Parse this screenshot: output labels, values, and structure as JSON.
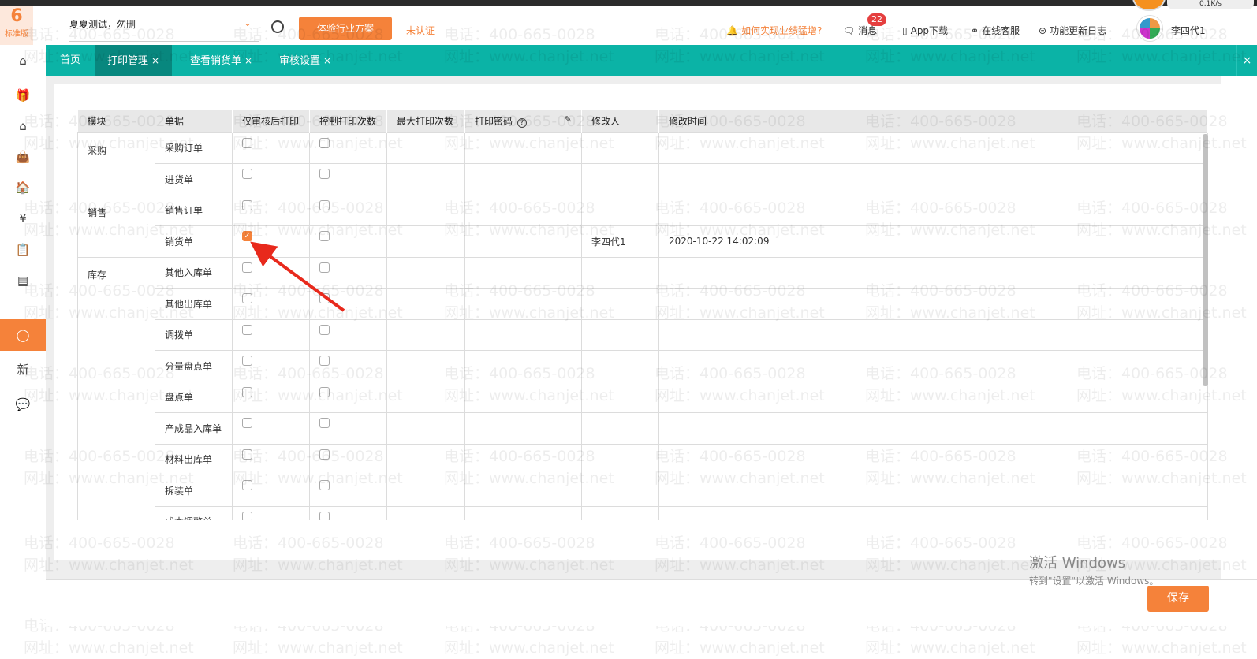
{
  "header": {
    "logo_text": "标准版",
    "company": "夏夏测试，勿删",
    "trial_button": "体验行业方案",
    "unverified": "未认证",
    "growth_link": "如何实现业绩猛增?",
    "messages": "消息",
    "message_count": "22",
    "app_download": "App下载",
    "online_service": "在线客服",
    "changelog": "功能更新日志",
    "username": "李四代1",
    "net_speed": "0.1K/s"
  },
  "tabs": [
    {
      "label": "首页",
      "closable": false
    },
    {
      "label": "打印管理",
      "closable": true,
      "active": true
    },
    {
      "label": "查看销货单",
      "closable": true
    },
    {
      "label": "审核设置",
      "closable": true
    }
  ],
  "tab_close_symbol": "×",
  "table": {
    "headers": [
      "模块",
      "单据",
      "仅审核后打印",
      "控制打印次数",
      "最大打印次数",
      "打印密码",
      "修改人",
      "修改时间"
    ],
    "groups": [
      {
        "module": "采购",
        "rows": [
          {
            "doc": "采购订单",
            "audit_only": false,
            "control": false,
            "modifier": "",
            "time": ""
          },
          {
            "doc": "进货单",
            "audit_only": false,
            "control": false,
            "modifier": "",
            "time": ""
          }
        ]
      },
      {
        "module": "销售",
        "rows": [
          {
            "doc": "销售订单",
            "audit_only": false,
            "control": false,
            "modifier": "",
            "time": ""
          },
          {
            "doc": "销货单",
            "audit_only": true,
            "control": false,
            "modifier": "李四代1",
            "time": "2020-10-22 14:02:09"
          }
        ]
      },
      {
        "module": "库存",
        "rows": [
          {
            "doc": "其他入库单",
            "audit_only": false,
            "control": false,
            "modifier": "",
            "time": ""
          },
          {
            "doc": "其他出库单",
            "audit_only": false,
            "control": false,
            "modifier": "",
            "time": ""
          },
          {
            "doc": "调拨单",
            "audit_only": false,
            "control": false,
            "modifier": "",
            "time": ""
          },
          {
            "doc": "分量盘点单",
            "audit_only": false,
            "control": false,
            "modifier": "",
            "time": ""
          },
          {
            "doc": "盘点单",
            "audit_only": false,
            "control": false,
            "modifier": "",
            "time": ""
          },
          {
            "doc": "产成品入库单",
            "audit_only": false,
            "control": false,
            "modifier": "",
            "time": ""
          },
          {
            "doc": "材料出库单",
            "audit_only": false,
            "control": false,
            "modifier": "",
            "time": ""
          },
          {
            "doc": "拆装单",
            "audit_only": false,
            "control": false,
            "modifier": "",
            "time": ""
          },
          {
            "doc": "成本调整单",
            "audit_only": false,
            "control": false,
            "modifier": "",
            "time": ""
          }
        ]
      }
    ]
  },
  "footer": {
    "save": "保存"
  },
  "windows_activation": {
    "title": "激活 Windows",
    "subtitle": "转到\"设置\"以激活 Windows。"
  },
  "watermark": {
    "phone": "电话：400-665-0028",
    "site": "网址：www.chanjet.net"
  },
  "colors": {
    "accent": "#f5823a",
    "teal": "#0bb3a6",
    "teal_active": "#08877e"
  }
}
